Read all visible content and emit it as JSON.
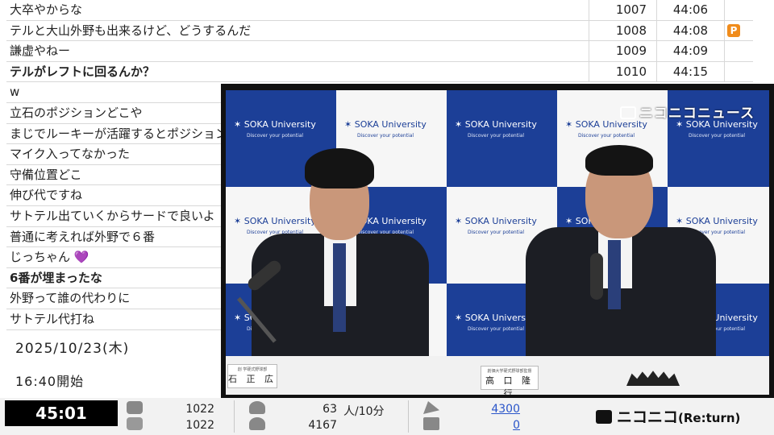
{
  "comments": [
    {
      "text": "大卒やからな",
      "no": "1007",
      "time": "44:06",
      "badge": "",
      "bold": false
    },
    {
      "text": "テルと大山外野も出来るけど、どうするんだ",
      "no": "1008",
      "time": "44:08",
      "badge": "P",
      "bold": false
    },
    {
      "text": "謙虚やねー",
      "no": "1009",
      "time": "44:09",
      "badge": "",
      "bold": false
    },
    {
      "text": "テルがレフトに回るんか？",
      "no": "1010",
      "time": "44:15",
      "badge": "",
      "bold": true
    },
    {
      "text": "w",
      "no": "",
      "time": "",
      "badge": "",
      "bold": false
    },
    {
      "text": "立石のポジションどこや",
      "no": "",
      "time": "",
      "badge": "",
      "bold": false
    },
    {
      "text": "まじでルーキーが活躍するとポジションにな",
      "no": "",
      "time": "",
      "badge": "",
      "bold": false
    },
    {
      "text": "マイク入ってなかった",
      "no": "",
      "time": "",
      "badge": "",
      "bold": false
    },
    {
      "text": "守備位置どこ",
      "no": "",
      "time": "",
      "badge": "",
      "bold": false
    },
    {
      "text": "伸び代ですね",
      "no": "",
      "time": "",
      "badge": "",
      "bold": false
    },
    {
      "text": "サトテル出ていくからサードで良いよ",
      "no": "",
      "time": "",
      "badge": "",
      "bold": false
    },
    {
      "text": "普通に考えれば外野で６番",
      "no": "",
      "time": "",
      "badge": "",
      "bold": false
    },
    {
      "text": "じっちゃん 💜",
      "no": "",
      "time": "",
      "badge": "",
      "bold": false
    },
    {
      "text": "6番が埋まったな",
      "no": "",
      "time": "",
      "badge": "",
      "bold": true
    },
    {
      "text": "外野って誰の代わりに",
      "no": "",
      "time": "",
      "badge": "",
      "bold": false
    },
    {
      "text": "サトテル代打ね",
      "no": "",
      "time": "",
      "badge": "",
      "bold": false
    }
  ],
  "broadcast": {
    "date": "2025/10/23(木)",
    "start": "16:40開始"
  },
  "video": {
    "backdrop_text": "SOKA University",
    "backdrop_sub": "Discover your potential",
    "news_logo": "ニコニコニュース",
    "nameplate_left": "石 正 広",
    "nameplate_left_small": "創 学硬式野球部",
    "nameplate_right": "高 口 隆 行",
    "nameplate_right_small": "創価大学硬式野球部監督"
  },
  "status": {
    "elapsed": "45:01",
    "comments_a": "1022",
    "comments_b": "1022",
    "viewers_rate": "63",
    "viewers_rate_unit": "人/10分",
    "viewers_total": "4167",
    "ad_points": "4300",
    "gift_points": "0",
    "logo": "ニコニコ",
    "logo_suffix": "(Re:turn)"
  },
  "colors": {
    "backdrop_blue": "#1c3f97",
    "badge_orange": "#f08c1c",
    "link_blue": "#2a55c9"
  }
}
